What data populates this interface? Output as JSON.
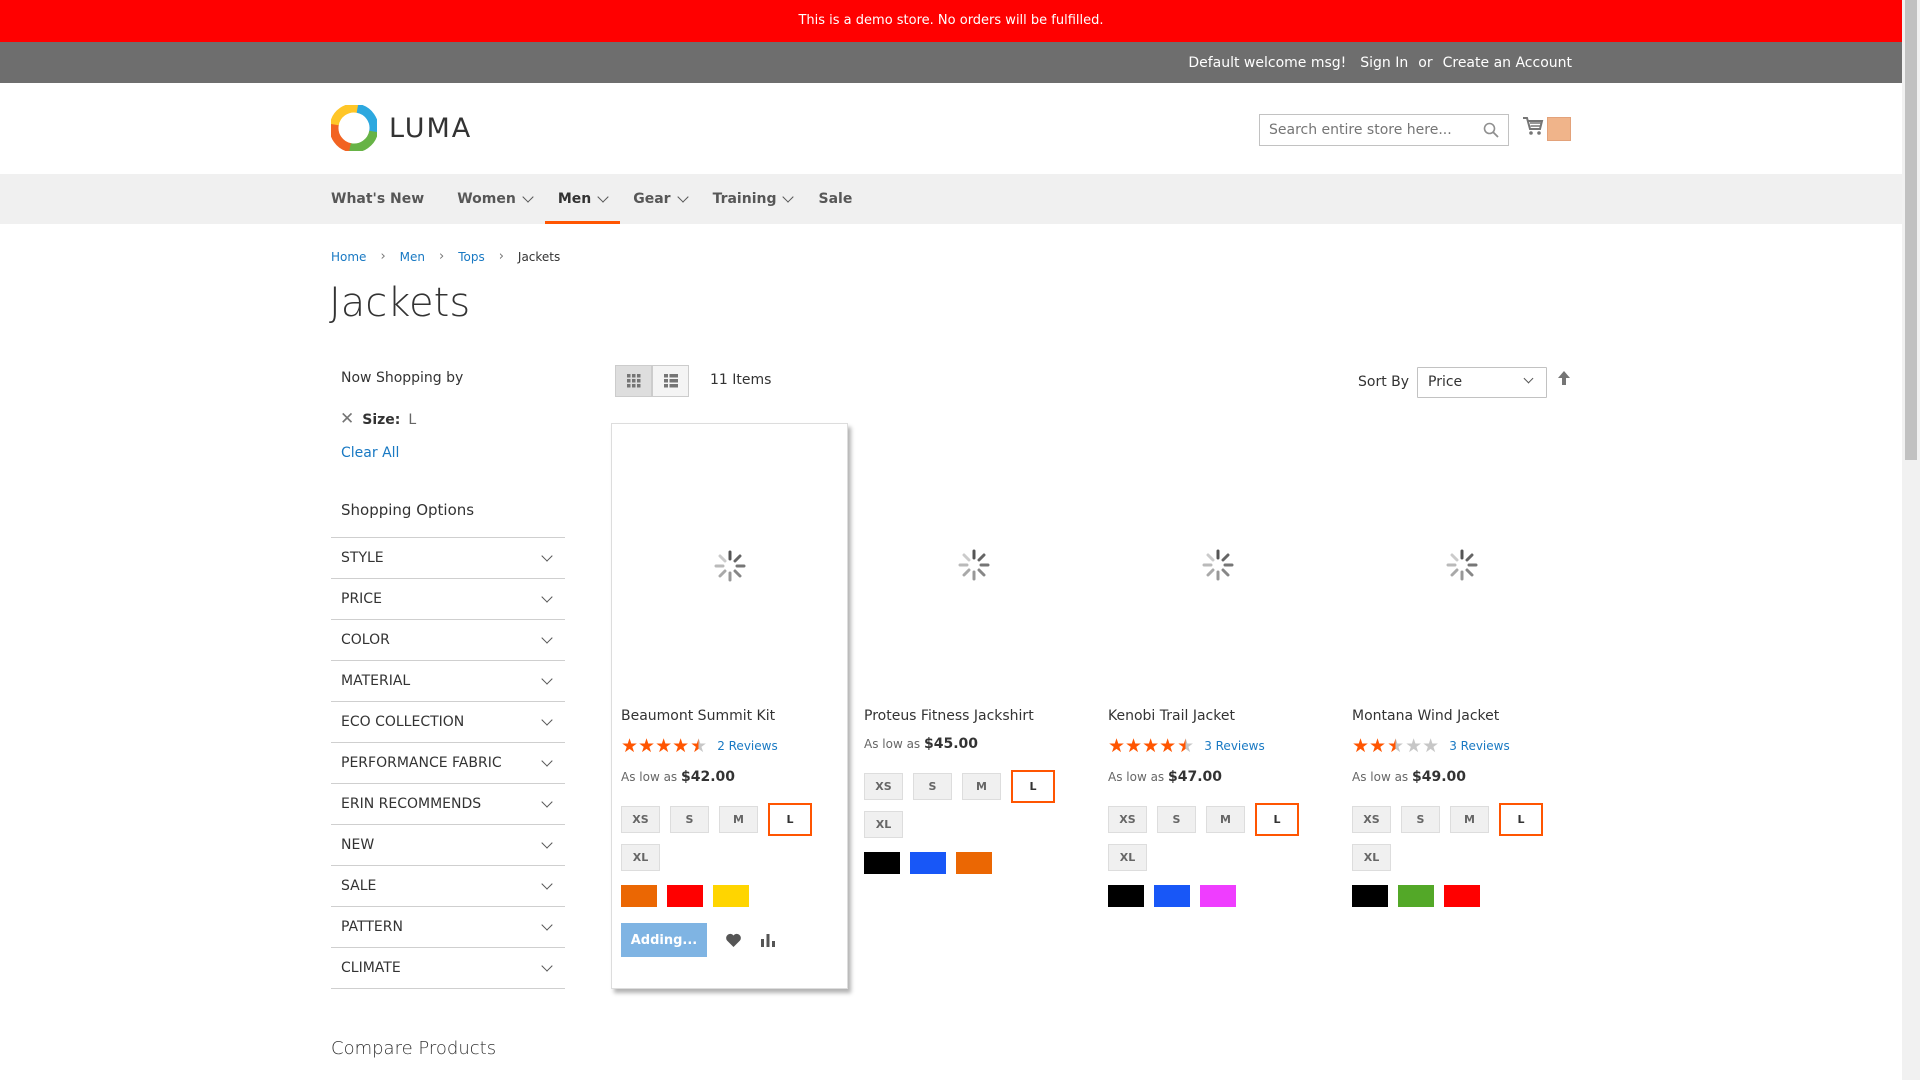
{
  "demo_notice": "This is a demo store. No orders will be fulfilled.",
  "header_panel": {
    "welcome": "Default welcome msg!",
    "sign_in": "Sign In",
    "or": "or",
    "create_account": "Create an Account"
  },
  "logo": {
    "text": "LUMA"
  },
  "search": {
    "placeholder": "Search entire store here..."
  },
  "nav": {
    "items": [
      {
        "label": "What's New"
      },
      {
        "label": "Women"
      },
      {
        "label": "Men"
      },
      {
        "label": "Gear"
      },
      {
        "label": "Training"
      },
      {
        "label": "Sale"
      }
    ]
  },
  "breadcrumb": {
    "home": "Home",
    "men": "Men",
    "tops": "Tops",
    "current": "Jackets"
  },
  "page_title": "Jackets",
  "sidebar": {
    "now_shopping": "Now Shopping by",
    "active_filter_label": "Size:",
    "active_filter_value": "L",
    "clear_all": "Clear All",
    "shopping_options": "Shopping Options",
    "options": [
      "STYLE",
      "PRICE",
      "COLOR",
      "MATERIAL",
      "ECO COLLECTION",
      "PERFORMANCE FABRIC",
      "ERIN RECOMMENDS",
      "NEW",
      "SALE",
      "PATTERN",
      "CLIMATE"
    ]
  },
  "compare_title": "Compare Products",
  "toolbar": {
    "items_count": "11 Items",
    "sort_label": "Sort By",
    "sort_value": "Price"
  },
  "products": [
    {
      "name": "Beaumont Summit Kit",
      "rating_stars": 4.5,
      "reviews": "2 Reviews",
      "price_prefix": "As low as",
      "price": "$42.00",
      "sizes": [
        "XS",
        "S",
        "M",
        "L",
        "XL"
      ],
      "selected_size": "L",
      "swatches": [
        "#eb6703",
        "#ff0000",
        "#ffd500"
      ],
      "add_button": "Adding..."
    },
    {
      "name": "Proteus Fitness Jackshirt",
      "rating_stars": 0,
      "reviews": "",
      "price_prefix": "As low as",
      "price": "$45.00",
      "sizes": [
        "XS",
        "S",
        "M",
        "L",
        "XL"
      ],
      "selected_size": "L",
      "swatches": [
        "#000000",
        "#1857f7",
        "#eb6703"
      ]
    },
    {
      "name": "Kenobi Trail Jacket",
      "rating_stars": 4.5,
      "reviews": "3 Reviews",
      "price_prefix": "As low as",
      "price": "$47.00",
      "sizes": [
        "XS",
        "S",
        "M",
        "L",
        "XL"
      ],
      "selected_size": "L",
      "swatches": [
        "#000000",
        "#1857f7",
        "#ef3dff"
      ]
    },
    {
      "name": "Montana Wind Jacket",
      "rating_stars": 2.5,
      "reviews": "3 Reviews",
      "price_prefix": "As low as",
      "price": "$49.00",
      "sizes": [
        "XS",
        "S",
        "M",
        "L",
        "XL"
      ],
      "selected_size": "L",
      "swatches": [
        "#000000",
        "#53a828",
        "#ff0000"
      ]
    }
  ],
  "colors": {
    "demo_bar": "#ff0000",
    "panel": "#6e6e6e",
    "accent": "#ff5501",
    "link": "#1979c3",
    "star": "#ff5501"
  }
}
